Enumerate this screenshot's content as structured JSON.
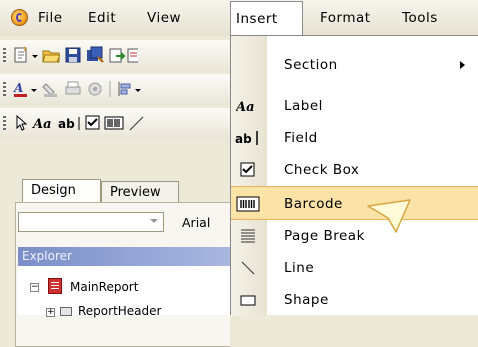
{
  "menubar": {
    "items": [
      {
        "label": "File"
      },
      {
        "label": "Edit"
      },
      {
        "label": "View"
      },
      {
        "label": "Insert"
      },
      {
        "label": "Format"
      },
      {
        "label": "Tools"
      }
    ]
  },
  "insert_menu": {
    "items": [
      {
        "label": "Section",
        "icon": "none",
        "has_submenu": true
      },
      {
        "label": "Label",
        "icon": "label-icon"
      },
      {
        "label": "Field",
        "icon": "field-icon"
      },
      {
        "label": "Check Box",
        "icon": "checkbox-icon"
      },
      {
        "label": "Barcode",
        "icon": "barcode-icon",
        "highlighted": true
      },
      {
        "label": "Page Break",
        "icon": "page-break-icon"
      },
      {
        "label": "Line",
        "icon": "line-icon"
      },
      {
        "label": "Shape",
        "icon": "shape-icon"
      }
    ]
  },
  "design_panel": {
    "tabs": [
      {
        "label": "Design"
      },
      {
        "label": "Preview"
      }
    ],
    "font_name": "Arial",
    "explorer_title": "Explorer",
    "tree": [
      {
        "label": "MainReport"
      },
      {
        "label": "ReportHeader"
      }
    ]
  },
  "colors": {
    "highlight": "#fbe2a6",
    "explorer_bar": "#7b8ec8"
  }
}
